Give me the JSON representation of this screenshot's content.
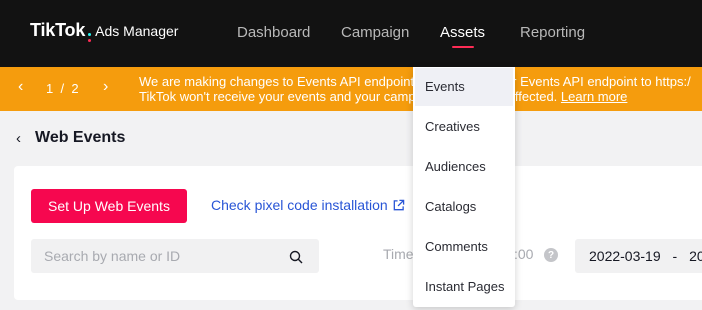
{
  "topbar": {
    "brand": "TikTok",
    "product": "Ads Manager",
    "nav": [
      "Dashboard",
      "Campaign",
      "Assets",
      "Reporting"
    ],
    "active_nav": "Assets"
  },
  "banner": {
    "page_current": "1",
    "page_sep": "/",
    "page_total": "2",
    "line1_left": "We are making changes to Events API endpoint.",
    "line1_right": "our Events API endpoint to https:/",
    "line2_left": "TikTok won't receive your events and your camp",
    "line2_right": "be affected.",
    "learn_more": "Learn more"
  },
  "page": {
    "title": "Web Events",
    "setup_button": "Set Up Web Events",
    "check_link": "Check pixel code installation",
    "search_placeholder": "Search by name or ID",
    "time_label": "Time",
    "time_suffix": ":00",
    "help_symbol": "?",
    "date_start": "2022-03-19",
    "date_sep": "-",
    "date_end": "20"
  },
  "assets_menu": {
    "items": [
      "Events",
      "Creatives",
      "Audiences",
      "Catalogs",
      "Comments",
      "Instant Pages"
    ],
    "selected": "Events"
  },
  "colors": {
    "topbar": "#121212",
    "banner": "#f59c0d",
    "primary": "#f6074f",
    "link": "#2855d6",
    "accent_cyan": "#25f4ee",
    "accent_pink": "#fe2c55"
  }
}
